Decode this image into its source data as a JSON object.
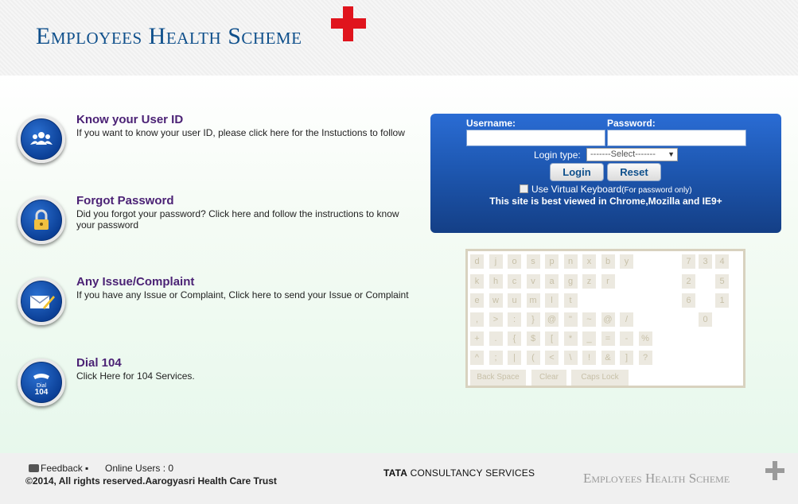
{
  "header": {
    "brand": "Employees Health Scheme"
  },
  "items": [
    {
      "title": "Know your User ID",
      "desc": "If you want to know your user ID, please click here for the Instuctions to follow"
    },
    {
      "title": "Forgot Password",
      "desc": "Did you forgot your password? Click here and follow the instructions to know your password"
    },
    {
      "title": "Any Issue/Complaint",
      "desc": "If you have any Issue or Complaint, Click here to send your Issue or Complaint"
    },
    {
      "title": "Dial 104",
      "desc": "Click Here for 104 Services."
    }
  ],
  "dial_icon_text": {
    "top": "Dial",
    "num": "104"
  },
  "login": {
    "username_label": "Username:",
    "password_label": "Password:",
    "username_value": "",
    "password_value": "",
    "login_type_label": "Login type:",
    "login_type_selected": "-------Select-------",
    "login_button": "Login",
    "reset_button": "Reset",
    "virtual_keyboard_label": "Use Virtual Keyboard",
    "virtual_keyboard_note": "(For password only)",
    "browser_note": "This site is best viewed in Chrome,Mozilla and IE9+"
  },
  "keyboard": {
    "rows": [
      [
        "d",
        "j",
        "o",
        "s",
        "p",
        "n",
        "x",
        "b",
        "y"
      ],
      [
        "k",
        "h",
        "c",
        "v",
        "a",
        "g",
        "z",
        "r"
      ],
      [
        "e",
        "w",
        "u",
        "m",
        "l",
        "t"
      ],
      [
        ",",
        ">",
        ":",
        "}",
        "@",
        "\"",
        "~",
        "@",
        "/"
      ],
      [
        "+",
        ".",
        "{",
        "$",
        "[",
        "*",
        "_",
        "=",
        "-",
        "%"
      ],
      [
        "^",
        ";",
        "|",
        "(",
        "<",
        "\\",
        "!",
        "&",
        "]",
        "?"
      ]
    ],
    "digits": [
      [
        "7",
        "3",
        "4"
      ],
      [
        "2",
        "5"
      ],
      [
        "6",
        "1"
      ],
      [
        "0"
      ]
    ],
    "back_space": "Back Space",
    "clear": "Clear",
    "caps_lock": "Caps Lock"
  },
  "footer": {
    "feedback": "Feedback",
    "online_users": "Online Users : 0",
    "copyright": "©2014, All rights reserved.Aarogyasri Health Care Trust",
    "tcs_bold": "TATA",
    "tcs_rest": " CONSULTANCY SERVICES",
    "brand": "Employees Health Scheme"
  }
}
